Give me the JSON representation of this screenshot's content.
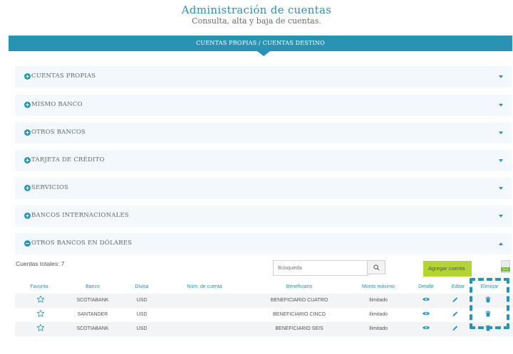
{
  "header": {
    "title": "Administración de cuentas",
    "subtitle": "Consulta, alta y baja de cuentas."
  },
  "main_tab": {
    "label": "CUENTAS PROPIAS / CUENTAS DESTINO"
  },
  "accordion": [
    {
      "label": "CUENTAS PROPIAS",
      "expanded": false
    },
    {
      "label": "MISMO BANCO",
      "expanded": false
    },
    {
      "label": "OTROS BANCOS",
      "expanded": false
    },
    {
      "label": "TARJETA DE CRÉDITO",
      "expanded": false
    },
    {
      "label": "SERVICIOS",
      "expanded": false
    },
    {
      "label": "BANCOS INTERNACIONALES",
      "expanded": false
    },
    {
      "label": "OTROS BANCOS EN DÓLARES",
      "expanded": true
    }
  ],
  "toolbar": {
    "total_label": "Cuentas totales: 7",
    "search_placeholder": "Búsqueda",
    "add_label": "Agregar cuenta",
    "export_label": "XLS"
  },
  "table": {
    "headers": [
      "Favorita",
      "Banco",
      "Divisa",
      "Núm. de cuenta",
      "Beneficiario",
      "Monto máximo",
      "Detalle",
      "Editar",
      "Eliminar"
    ],
    "rows": [
      {
        "bank": "SCOTIABANK",
        "currency": "USD",
        "account": "",
        "beneficiary": "BENEFICIARIO CUATRO",
        "max_amount": "Ilimitado"
      },
      {
        "bank": "SANTANDER",
        "currency": "USD",
        "account": "",
        "beneficiary": "BENEFICIARIO CINCO",
        "max_amount": "Ilimitado"
      },
      {
        "bank": "SCOTIABANK",
        "currency": "USD",
        "account": "",
        "beneficiary": "BENEFICIARIO SEIS",
        "max_amount": "Ilimitado"
      }
    ]
  },
  "colors": {
    "accent": "#2a93b5",
    "add_button": "#b4d334",
    "panel_bg": "#f2f8fb"
  },
  "icons": [
    "plus-circle-icon",
    "minus-circle-icon",
    "caret-down-icon",
    "caret-up-icon",
    "search-icon",
    "xls-icon",
    "star-icon",
    "eye-icon",
    "pencil-icon",
    "trash-icon"
  ]
}
